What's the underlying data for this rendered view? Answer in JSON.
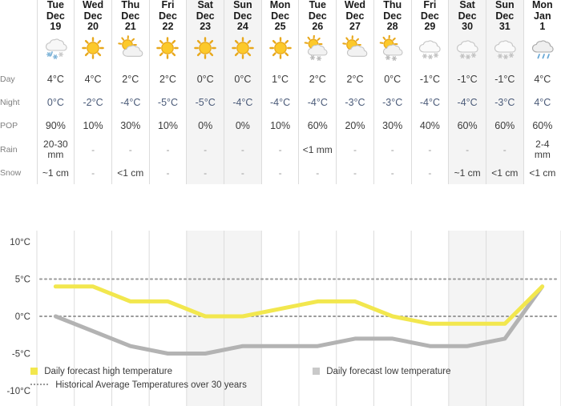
{
  "row_labels": {
    "day": "Day",
    "night": "Night",
    "pop": "POP",
    "rain": "Rain",
    "snow": "Snow"
  },
  "days": [
    {
      "weekday": "Tue",
      "month": "Dec",
      "date": "19",
      "weekend": false,
      "icon": "snow-rain-cloud-icon",
      "day": "4°C",
      "night": "0°C",
      "pop": "90%",
      "rain": "20-30 mm",
      "snow": "~1 cm"
    },
    {
      "weekday": "Wed",
      "month": "Dec",
      "date": "20",
      "weekend": false,
      "icon": "sunny-icon",
      "day": "4°C",
      "night": "-2°C",
      "pop": "10%",
      "rain": "-",
      "snow": "-"
    },
    {
      "weekday": "Thu",
      "month": "Dec",
      "date": "21",
      "weekend": false,
      "icon": "partly-sunny-icon",
      "day": "2°C",
      "night": "-4°C",
      "pop": "30%",
      "rain": "-",
      "snow": "<1 cm"
    },
    {
      "weekday": "Fri",
      "month": "Dec",
      "date": "22",
      "weekend": false,
      "icon": "sunny-icon",
      "day": "2°C",
      "night": "-5°C",
      "pop": "10%",
      "rain": "-",
      "snow": "-"
    },
    {
      "weekday": "Sat",
      "month": "Dec",
      "date": "23",
      "weekend": true,
      "icon": "sunny-icon",
      "day": "0°C",
      "night": "-5°C",
      "pop": "0%",
      "rain": "-",
      "snow": "-"
    },
    {
      "weekday": "Sun",
      "month": "Dec",
      "date": "24",
      "weekend": true,
      "icon": "sunny-icon",
      "day": "0°C",
      "night": "-4°C",
      "pop": "0%",
      "rain": "-",
      "snow": "-"
    },
    {
      "weekday": "Mon",
      "month": "Dec",
      "date": "25",
      "weekend": false,
      "icon": "sunny-icon",
      "day": "1°C",
      "night": "-4°C",
      "pop": "10%",
      "rain": "-",
      "snow": "-"
    },
    {
      "weekday": "Tue",
      "month": "Dec",
      "date": "26",
      "weekend": false,
      "icon": "sun-cloud-snow-icon",
      "day": "2°C",
      "night": "-4°C",
      "pop": "60%",
      "rain": "<1 mm",
      "snow": "-"
    },
    {
      "weekday": "Wed",
      "month": "Dec",
      "date": "27",
      "weekend": false,
      "icon": "sun-cloud-icon",
      "day": "2°C",
      "night": "-3°C",
      "pop": "20%",
      "rain": "-",
      "snow": "-"
    },
    {
      "weekday": "Thu",
      "month": "Dec",
      "date": "28",
      "weekend": false,
      "icon": "sun-cloud-snow-icon",
      "day": "0°C",
      "night": "-3°C",
      "pop": "30%",
      "rain": "-",
      "snow": "-"
    },
    {
      "weekday": "Fri",
      "month": "Dec",
      "date": "29",
      "weekend": false,
      "icon": "cloud-snow-icon",
      "day": "-1°C",
      "night": "-4°C",
      "pop": "40%",
      "rain": "-",
      "snow": "-"
    },
    {
      "weekday": "Sat",
      "month": "Dec",
      "date": "30",
      "weekend": true,
      "icon": "cloud-snow-icon",
      "day": "-1°C",
      "night": "-4°C",
      "pop": "60%",
      "rain": "-",
      "snow": "~1 cm"
    },
    {
      "weekday": "Sun",
      "month": "Dec",
      "date": "31",
      "weekend": true,
      "icon": "cloud-snow-icon",
      "day": "-1°C",
      "night": "-3°C",
      "pop": "60%",
      "rain": "-",
      "snow": "<1 cm"
    },
    {
      "weekday": "Mon",
      "month": "Jan",
      "date": "1",
      "weekend": false,
      "icon": "rain-cloud-icon",
      "day": "4°C",
      "night": "4°C",
      "pop": "60%",
      "rain": "2-4 mm",
      "snow": "<1 cm"
    }
  ],
  "legend": {
    "high": "Daily forecast high temperature",
    "low": "Daily forecast low temperature",
    "historical": "Historical Average Temperatures over 30 years"
  },
  "colors": {
    "high_line": "#f2e74e",
    "low_line": "#b3b3b3",
    "historical_line": "#9a9a9a",
    "weekend_bg": "#f4f4f4",
    "grid": "#dcdcdc",
    "night_text": "#4a5a78"
  },
  "chart_data": {
    "type": "line",
    "title": "",
    "xlabel": "",
    "ylabel": "",
    "ylim": [
      -10,
      10
    ],
    "yticks": [
      10,
      5,
      0,
      -5,
      -10
    ],
    "ytick_labels": [
      "10°C",
      "5°C",
      "0°C",
      "-5°C",
      "-10°C"
    ],
    "grid": true,
    "legend_position": "bottom",
    "categories": [
      "Dec 19",
      "Dec 20",
      "Dec 21",
      "Dec 22",
      "Dec 23",
      "Dec 24",
      "Dec 25",
      "Dec 26",
      "Dec 27",
      "Dec 28",
      "Dec 29",
      "Dec 30",
      "Dec 31",
      "Jan 1"
    ],
    "series": [
      {
        "name": "Daily forecast high temperature",
        "color": "#f2e74e",
        "values": [
          4,
          4,
          2,
          2,
          0,
          0,
          1,
          2,
          2,
          0,
          -1,
          -1,
          -1,
          4
        ]
      },
      {
        "name": "Daily forecast low temperature",
        "color": "#b3b3b3",
        "values": [
          0,
          -2,
          -4,
          -5,
          -5,
          -4,
          -4,
          -4,
          -3,
          -3,
          -4,
          -4,
          -3,
          4
        ]
      },
      {
        "name": "Historical Average Temperatures over 30 years (high)",
        "color": "#9a9a9a",
        "style": "dotted",
        "values": [
          5,
          5,
          5,
          5,
          5,
          5,
          5,
          5,
          5,
          5,
          5,
          5,
          5,
          5
        ]
      },
      {
        "name": "Historical Average Temperatures over 30 years (low)",
        "color": "#9a9a9a",
        "style": "dotted",
        "values": [
          0,
          0,
          0,
          0,
          0,
          0,
          0,
          0,
          0,
          0,
          0,
          0,
          0,
          0
        ]
      }
    ]
  }
}
